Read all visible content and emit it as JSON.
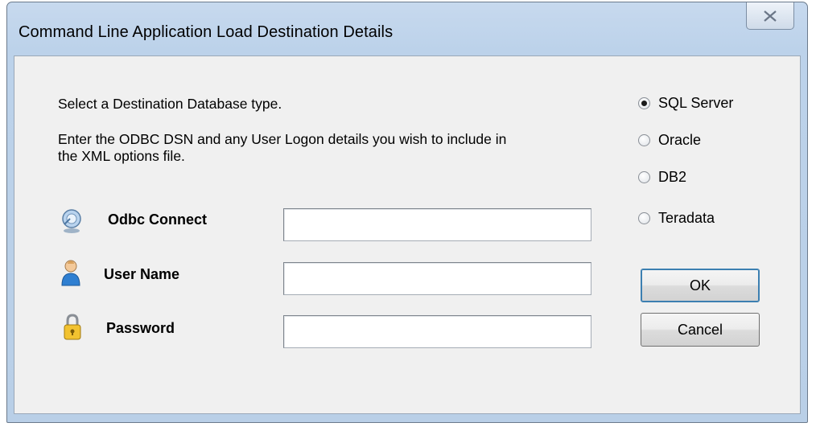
{
  "window": {
    "title": "Command Line Application Load Destination Details"
  },
  "instructions": {
    "select_type": "Select a Destination Database type.",
    "enter_dsn_line1": "Enter the ODBC DSN and any User Logon details you wish to include in",
    "enter_dsn_line2": "the XML options file."
  },
  "fields": [
    {
      "label": "Odbc Connect",
      "value": "",
      "icon": "odbc-connect-icon"
    },
    {
      "label": "User Name",
      "value": "",
      "icon": "user-icon"
    },
    {
      "label": "Password",
      "value": "",
      "icon": "lock-icon"
    }
  ],
  "database_types": {
    "selected": "SQL Server",
    "options": [
      "SQL Server",
      "Oracle",
      "DB2",
      "Teradata"
    ]
  },
  "buttons": {
    "ok": "OK",
    "cancel": "Cancel"
  }
}
